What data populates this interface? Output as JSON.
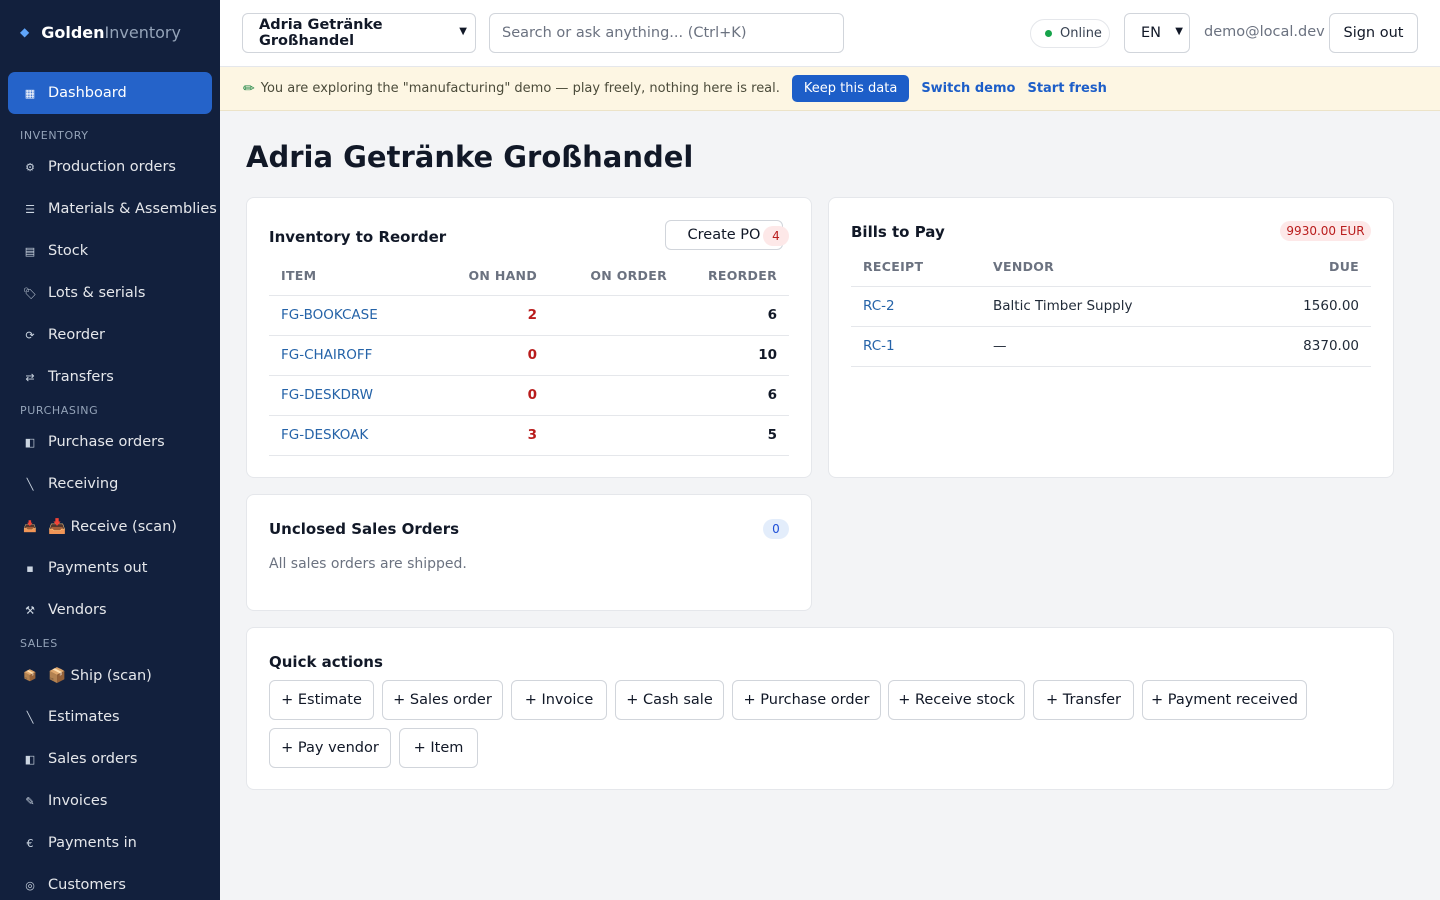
{
  "brand": {
    "part1": "Golden",
    "part2": "Inventory"
  },
  "sidebar": {
    "dashboard": "Dashboard",
    "inventory_section": "INVENTORY",
    "inventory": [
      "Production orders",
      "Materials & Assemblies",
      "Stock",
      "Lots & serials",
      "Reorder",
      "Transfers"
    ],
    "purchasing_section": "PURCHASING",
    "purchasing": [
      "Purchase orders",
      "Receiving",
      "📥 Receive (scan)",
      "Payments out",
      "Vendors"
    ],
    "sales_section": "SALES",
    "sales": [
      "📦 Ship (scan)",
      "Estimates",
      "Sales orders",
      "Invoices",
      "Payments in",
      "Customers"
    ]
  },
  "topbar": {
    "company": "Adria Getränke Großhandel",
    "search_placeholder": "Search or ask anything...  (Ctrl+K)",
    "status": "Online",
    "language": "EN",
    "email": "demo@local.dev",
    "sign_out": "Sign out"
  },
  "banner": {
    "message": "You are exploring the \"manufacturing\" demo — play freely, nothing here is real.",
    "keep": "Keep this data",
    "switch": "Switch demo",
    "fresh": "Start fresh"
  },
  "page": {
    "title": "Adria Getränke Großhandel"
  },
  "reorder": {
    "title": "Inventory to Reorder",
    "create_po": "Create PO",
    "count": "4",
    "headers": [
      "ITEM",
      "ON HAND",
      "ON ORDER",
      "REORDER"
    ],
    "rows": [
      {
        "item": "FG-BOOKCASE",
        "on_hand": "2",
        "on_order": "",
        "reorder": "6"
      },
      {
        "item": "FG-CHAIROFF",
        "on_hand": "0",
        "on_order": "",
        "reorder": "10"
      },
      {
        "item": "FG-DESKDRW",
        "on_hand": "0",
        "on_order": "",
        "reorder": "6"
      },
      {
        "item": "FG-DESKOAK",
        "on_hand": "3",
        "on_order": "",
        "reorder": "5"
      }
    ]
  },
  "bills": {
    "title": "Bills to Pay",
    "total": "9930.00 EUR",
    "headers": [
      "RECEIPT",
      "VENDOR",
      "DUE"
    ],
    "rows": [
      {
        "receipt": "RC-2",
        "vendor": "Baltic Timber Supply",
        "due": "1560.00"
      },
      {
        "receipt": "RC-1",
        "vendor": "—",
        "due": "8370.00"
      }
    ]
  },
  "unclosed": {
    "title": "Unclosed Sales Orders",
    "count": "0",
    "message": "All sales orders are shipped."
  },
  "quick": {
    "title": "Quick actions",
    "actions": [
      "+ Estimate",
      "+ Sales order",
      "+ Invoice",
      "+ Cash sale",
      "+ Purchase order",
      "+ Receive stock",
      "+ Transfer",
      "+ Payment received",
      "+ Pay vendor",
      "+ Item"
    ]
  }
}
